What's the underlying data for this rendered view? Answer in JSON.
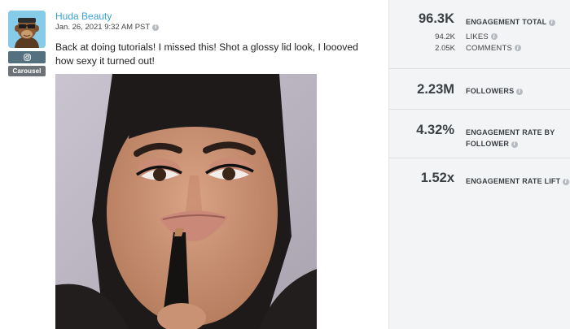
{
  "post": {
    "author": "Huda Beauty",
    "timestamp": "Jan. 26, 2021 9:32 AM PST",
    "platform_icon": "instagram-icon",
    "media_type": "Carousel",
    "caption": "Back at doing tutorials! I missed this! Shot a glossy lid look, I loooved how sexy it turned out!"
  },
  "stats": {
    "engagement_total": {
      "value": "96.3K",
      "label": "ENGAGEMENT TOTAL"
    },
    "likes": {
      "value": "94.2K",
      "label": "LIKES"
    },
    "comments": {
      "value": "2.05K",
      "label": "COMMENTS"
    },
    "followers": {
      "value": "2.23M",
      "label": "FOLLOWERS"
    },
    "engagement_rate": {
      "value": "4.32%",
      "label_line1": "ENGAGEMENT RATE BY",
      "label_line2": "FOLLOWER"
    },
    "engagement_rate_lift": {
      "value": "1.52x",
      "label": "ENGAGEMENT RATE LIFT"
    }
  },
  "colors": {
    "link_blue": "#3aa0d8",
    "stats_bg": "#f3f4f6",
    "badge_platform": "#55707e",
    "badge_type": "#6c7278"
  }
}
